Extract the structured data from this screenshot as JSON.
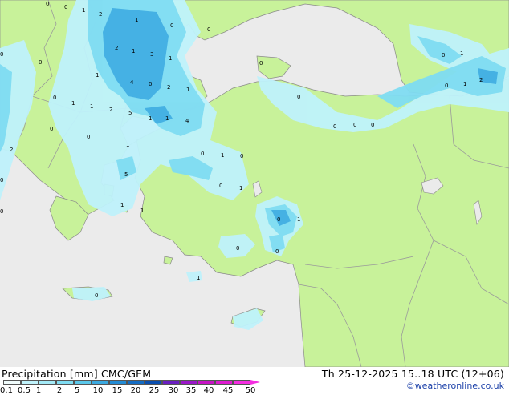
{
  "legend": {
    "title": "Precipitation [mm]  CMC/GEM",
    "valid_time": "Th 25-12-2025 15..18 UTC (12+06)",
    "credit": "©weatheronline.co.uk",
    "scale_labels": [
      "0.1",
      "0.5",
      "1",
      "2",
      "5",
      "10",
      "15",
      "20",
      "25",
      "30",
      "35",
      "40",
      "45",
      "50"
    ],
    "scale_colors": [
      "#f0fcfc",
      "#bff2fb",
      "#a4eaf7",
      "#7fdcf2",
      "#5ac7ea",
      "#3ba9e0",
      "#238bd4",
      "#146cc3",
      "#0b4fb0",
      "#6a1ec0",
      "#9a17c8",
      "#c614c4",
      "#de1bd0",
      "#f42ee0"
    ]
  },
  "colors": {
    "sea": "#ebebeb",
    "land": "#c8f29a",
    "border": "#9a9a9a",
    "coast": "#8a8a8a"
  },
  "point_values": [
    "0",
    "1",
    "2",
    "0",
    "1",
    "0",
    "0",
    "2",
    "1",
    "3",
    "1",
    "0",
    "1",
    "4",
    "0",
    "2",
    "1",
    "0",
    "1",
    "1",
    "2",
    "5",
    "1",
    "4",
    "1",
    "0",
    "2",
    "0",
    "1",
    "0",
    "1",
    "0",
    "0",
    "0",
    "0",
    "0",
    "0",
    "2",
    "0",
    "5",
    "0",
    "0",
    "1",
    "1",
    "0",
    "1",
    "1",
    "1",
    "0",
    "1",
    "0",
    "0",
    "1",
    "0",
    "0",
    "0"
  ]
}
